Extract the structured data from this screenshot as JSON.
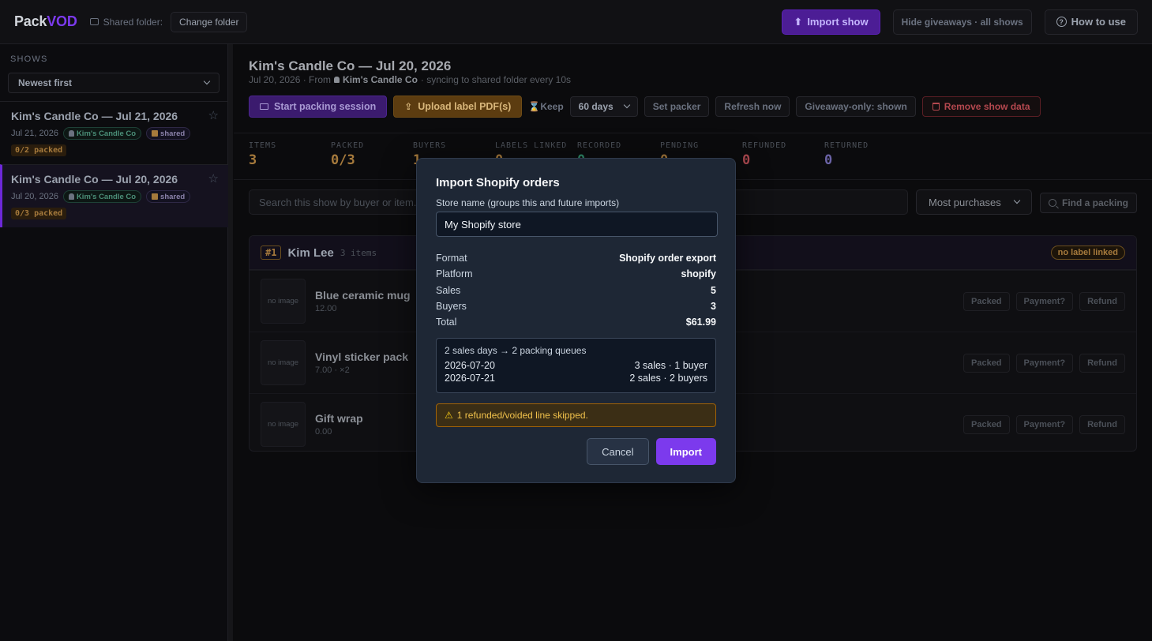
{
  "topbar": {
    "logo_part1": "Pack",
    "logo_part2": "VOD",
    "folder_label": "Shared folder:",
    "change_folder": "Change folder",
    "import_show": "Import show",
    "hide_giveaways": "Hide giveaways · all shows",
    "how_to_use": "How to use"
  },
  "sidebar": {
    "section_label": "SHOWS",
    "sort_value": "Newest first",
    "shows": [
      {
        "title": "Kim's Candle Co — Jul 21, 2026",
        "date": "Jul 21, 2026",
        "seller": "Kim's Candle Co",
        "shared": "shared",
        "packed": "0/2 packed"
      },
      {
        "title": "Kim's Candle Co — Jul 20, 2026",
        "date": "Jul 20, 2026",
        "seller": "Kim's Candle Co",
        "shared": "shared",
        "packed": "0/3 packed"
      }
    ]
  },
  "main": {
    "title": "Kim's Candle Co — Jul 20, 2026",
    "sub_date": "Jul 20, 2026 · From",
    "sub_seller": "Kim's Candle Co",
    "sub_sync": "· syncing to shared folder every 10s",
    "actions": {
      "start_packing": "Start packing session",
      "upload_labels": "Upload label PDF(s)",
      "keep": "Keep",
      "keep_value": "60 days",
      "set_packer": "Set packer",
      "refresh_now": "Refresh now",
      "giveaway_only": "Giveaway-only: shown",
      "remove_data": "Remove show data"
    },
    "stats": [
      {
        "label": "ITEMS",
        "value": "3",
        "color": "#a67a3c"
      },
      {
        "label": "PACKED",
        "value": "0/3",
        "color": "#a67a3c"
      },
      {
        "label": "BUYERS",
        "value": "1",
        "color": "#a67a3c"
      },
      {
        "label": "LABELS LINKED",
        "value": "0",
        "color": "#a67a3c"
      },
      {
        "label": "RECORDED",
        "value": "0",
        "color": "#2f8a6a"
      },
      {
        "label": "PENDING",
        "value": "0",
        "color": "#a67a3c"
      },
      {
        "label": "REFUNDED",
        "value": "0",
        "color": "#a8474e"
      },
      {
        "label": "RETURNED",
        "value": "0",
        "color": "#6b63a6"
      }
    ],
    "search_placeholder": "Search this show by buyer or item...",
    "sort_value": "Most purchases",
    "find_packing": "Find a packing",
    "buyer": {
      "rank": "#1",
      "name": "Kim Lee",
      "count": "3 items",
      "label_status": "no label linked",
      "items": [
        {
          "name": "Blue ceramic mug",
          "price": "12.00",
          "thumb": "no image"
        },
        {
          "name": "Vinyl sticker pack",
          "price": "7.00 · ×2",
          "thumb": "no image"
        },
        {
          "name": "Gift wrap",
          "price": "0.00",
          "thumb": "no image"
        }
      ],
      "row_buttons": {
        "packed": "Packed",
        "payment": "Payment?",
        "refund": "Refund"
      }
    }
  },
  "modal": {
    "title": "Import Shopify orders",
    "store_label": "Store name (groups this and future imports)",
    "store_value": "My Shopify store",
    "summary": [
      {
        "k": "Format",
        "v": "Shopify order export"
      },
      {
        "k": "Platform",
        "v": "shopify"
      },
      {
        "k": "Sales",
        "v": "5"
      },
      {
        "k": "Buyers",
        "v": "3"
      },
      {
        "k": "Total",
        "v": "$61.99"
      }
    ],
    "days_title": "2 sales days → 2 packing queues",
    "days": [
      {
        "date": "2026-07-20",
        "info": "3 sales · 1 buyer"
      },
      {
        "date": "2026-07-21",
        "info": "2 sales · 2 buyers"
      }
    ],
    "warning": "1 refunded/voided line skipped.",
    "cancel": "Cancel",
    "import": "Import"
  }
}
